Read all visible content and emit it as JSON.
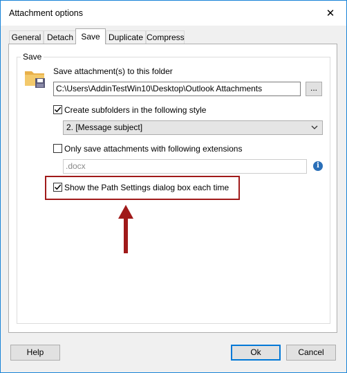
{
  "window": {
    "title": "Attachment options",
    "close_glyph": "✕"
  },
  "tabs": [
    {
      "label": "General"
    },
    {
      "label": "Detach"
    },
    {
      "label": "Save"
    },
    {
      "label": "Duplicate"
    },
    {
      "label": "Compress"
    }
  ],
  "active_tab": "Save",
  "group": {
    "label": "Save",
    "save_to_folder_label": "Save attachment(s) to this folder",
    "folder_path": "C:\\Users\\AddinTestWin10\\Desktop\\Outlook Attachments",
    "browse_label": "...",
    "create_subfolders": {
      "label": "Create subfolders in the following style",
      "checked": true
    },
    "subfolder_style": {
      "selected": "2. [Message subject]"
    },
    "only_extensions": {
      "label": "Only save attachments with following extensions",
      "checked": false
    },
    "extensions_value": ".docx",
    "info_glyph": "i",
    "show_path_dialog": {
      "label": "Show the Path Settings dialog box each time",
      "checked": true
    }
  },
  "buttons": {
    "help": "Help",
    "ok": "Ok",
    "cancel": "Cancel"
  },
  "colors": {
    "accent": "#0078d7",
    "highlight": "#a01a1a",
    "arrow": "#a01a1a",
    "info": "#2a6fb8"
  }
}
